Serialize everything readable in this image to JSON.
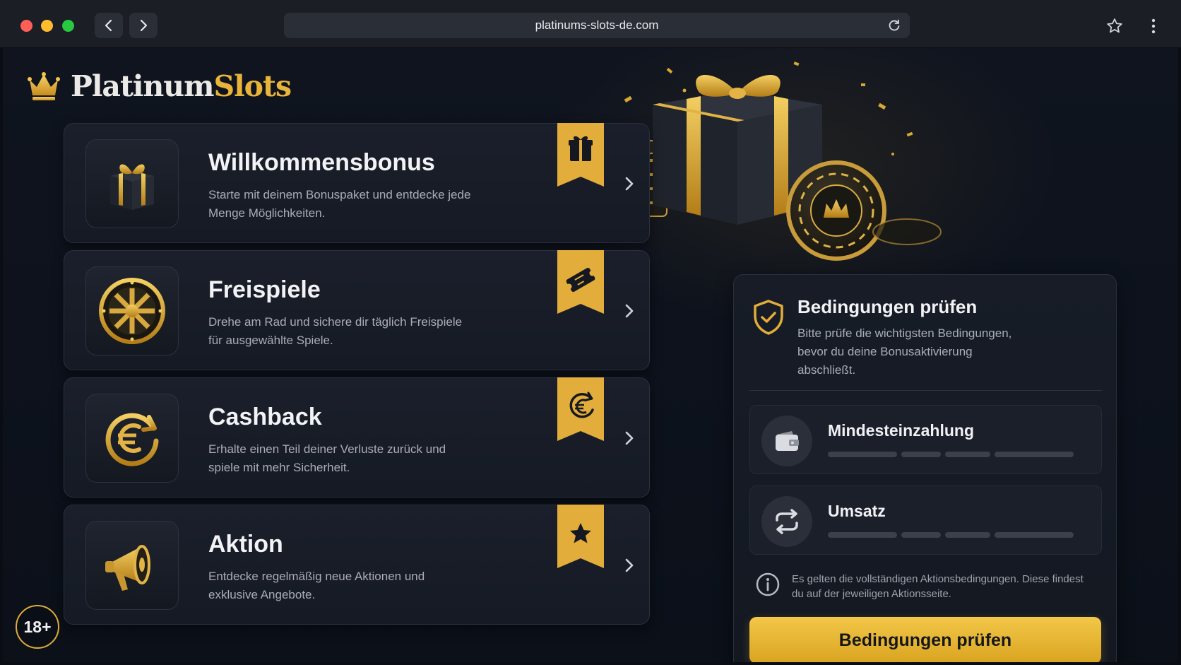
{
  "browser": {
    "url": "platinums-slots-de.com"
  },
  "brand": {
    "name_part1": "Platinum",
    "name_part2": "Slots",
    "accent_color": "#e8b43a"
  },
  "promos": [
    {
      "title": "Willkommensbonus",
      "description": "Starte mit deinem Bonuspaket und entdecke jede Menge Möglichkeiten.",
      "icon": "gift-icon",
      "ribbon_icon": "gift-icon"
    },
    {
      "title": "Freispiele",
      "description": "Drehe am Rad und sichere dir täglich Freispiele für ausgewählte Spiele.",
      "icon": "wheel-icon",
      "ribbon_icon": "ticket-icon"
    },
    {
      "title": "Cashback",
      "description": "Erhalte einen Teil deiner Verluste zurück und spiele mit mehr Sicherheit.",
      "icon": "euro-cycle-icon",
      "ribbon_icon": "euro-cycle-icon"
    },
    {
      "title": "Aktion",
      "description": "Entdecke regelmäßig neue Aktionen und exklusive Angebote.",
      "icon": "megaphone-icon",
      "ribbon_icon": "star-icon"
    }
  ],
  "conditions": {
    "title": "Bedingungen prüfen",
    "description": "Bitte prüfe die wichtigsten Bedingungen, bevor du deine Bonusaktivierung abschließt.",
    "requirements": [
      {
        "label": "Mindesteinzahlung",
        "icon": "wallet-icon"
      },
      {
        "label": "Umsatz",
        "icon": "refresh-arrows-icon"
      }
    ],
    "info": "Es gelten die vollständigen Aktionsbedingungen. Diese findest du auf der jeweiligen Aktionsseite.",
    "button_label": "Bedingungen prüfen"
  },
  "age_badge": "18+"
}
